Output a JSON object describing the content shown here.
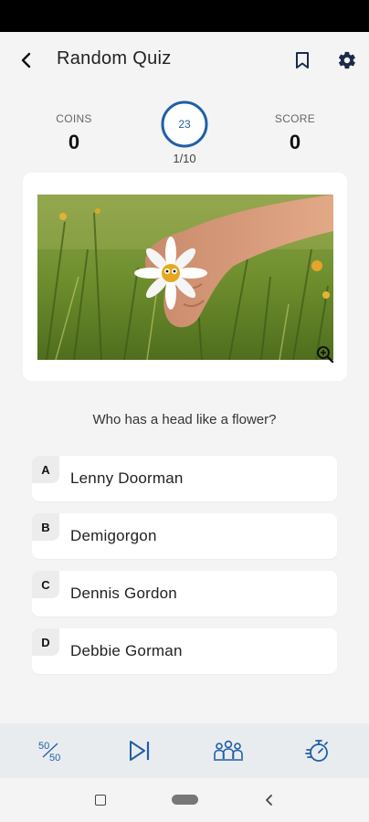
{
  "header": {
    "title": "Random Quiz"
  },
  "stats": {
    "coins_label": "COINS",
    "coins_value": "0",
    "timer_value": "23",
    "progress": "1/10",
    "score_label": "SCORE",
    "score_value": "0"
  },
  "question": {
    "text": "Who has a head like a flower?"
  },
  "options": [
    {
      "letter": "A",
      "text": "Lenny Doorman"
    },
    {
      "letter": "B",
      "text": "Demigorgon"
    },
    {
      "letter": "C",
      "text": "Dennis Gordon"
    },
    {
      "letter": "D",
      "text": "Debbie Gorman"
    }
  ],
  "tools": [
    {
      "name": "fifty-fifty",
      "icon": "fifty-fifty-icon"
    },
    {
      "name": "skip",
      "icon": "skip-next-icon"
    },
    {
      "name": "audience",
      "icon": "audience-icon"
    },
    {
      "name": "extra-time",
      "icon": "stopwatch-icon"
    }
  ],
  "colors": {
    "accent": "#1f5fa8",
    "background": "#f4f4f4",
    "card": "#ffffff",
    "bottom_bar": "#e9ecef"
  }
}
